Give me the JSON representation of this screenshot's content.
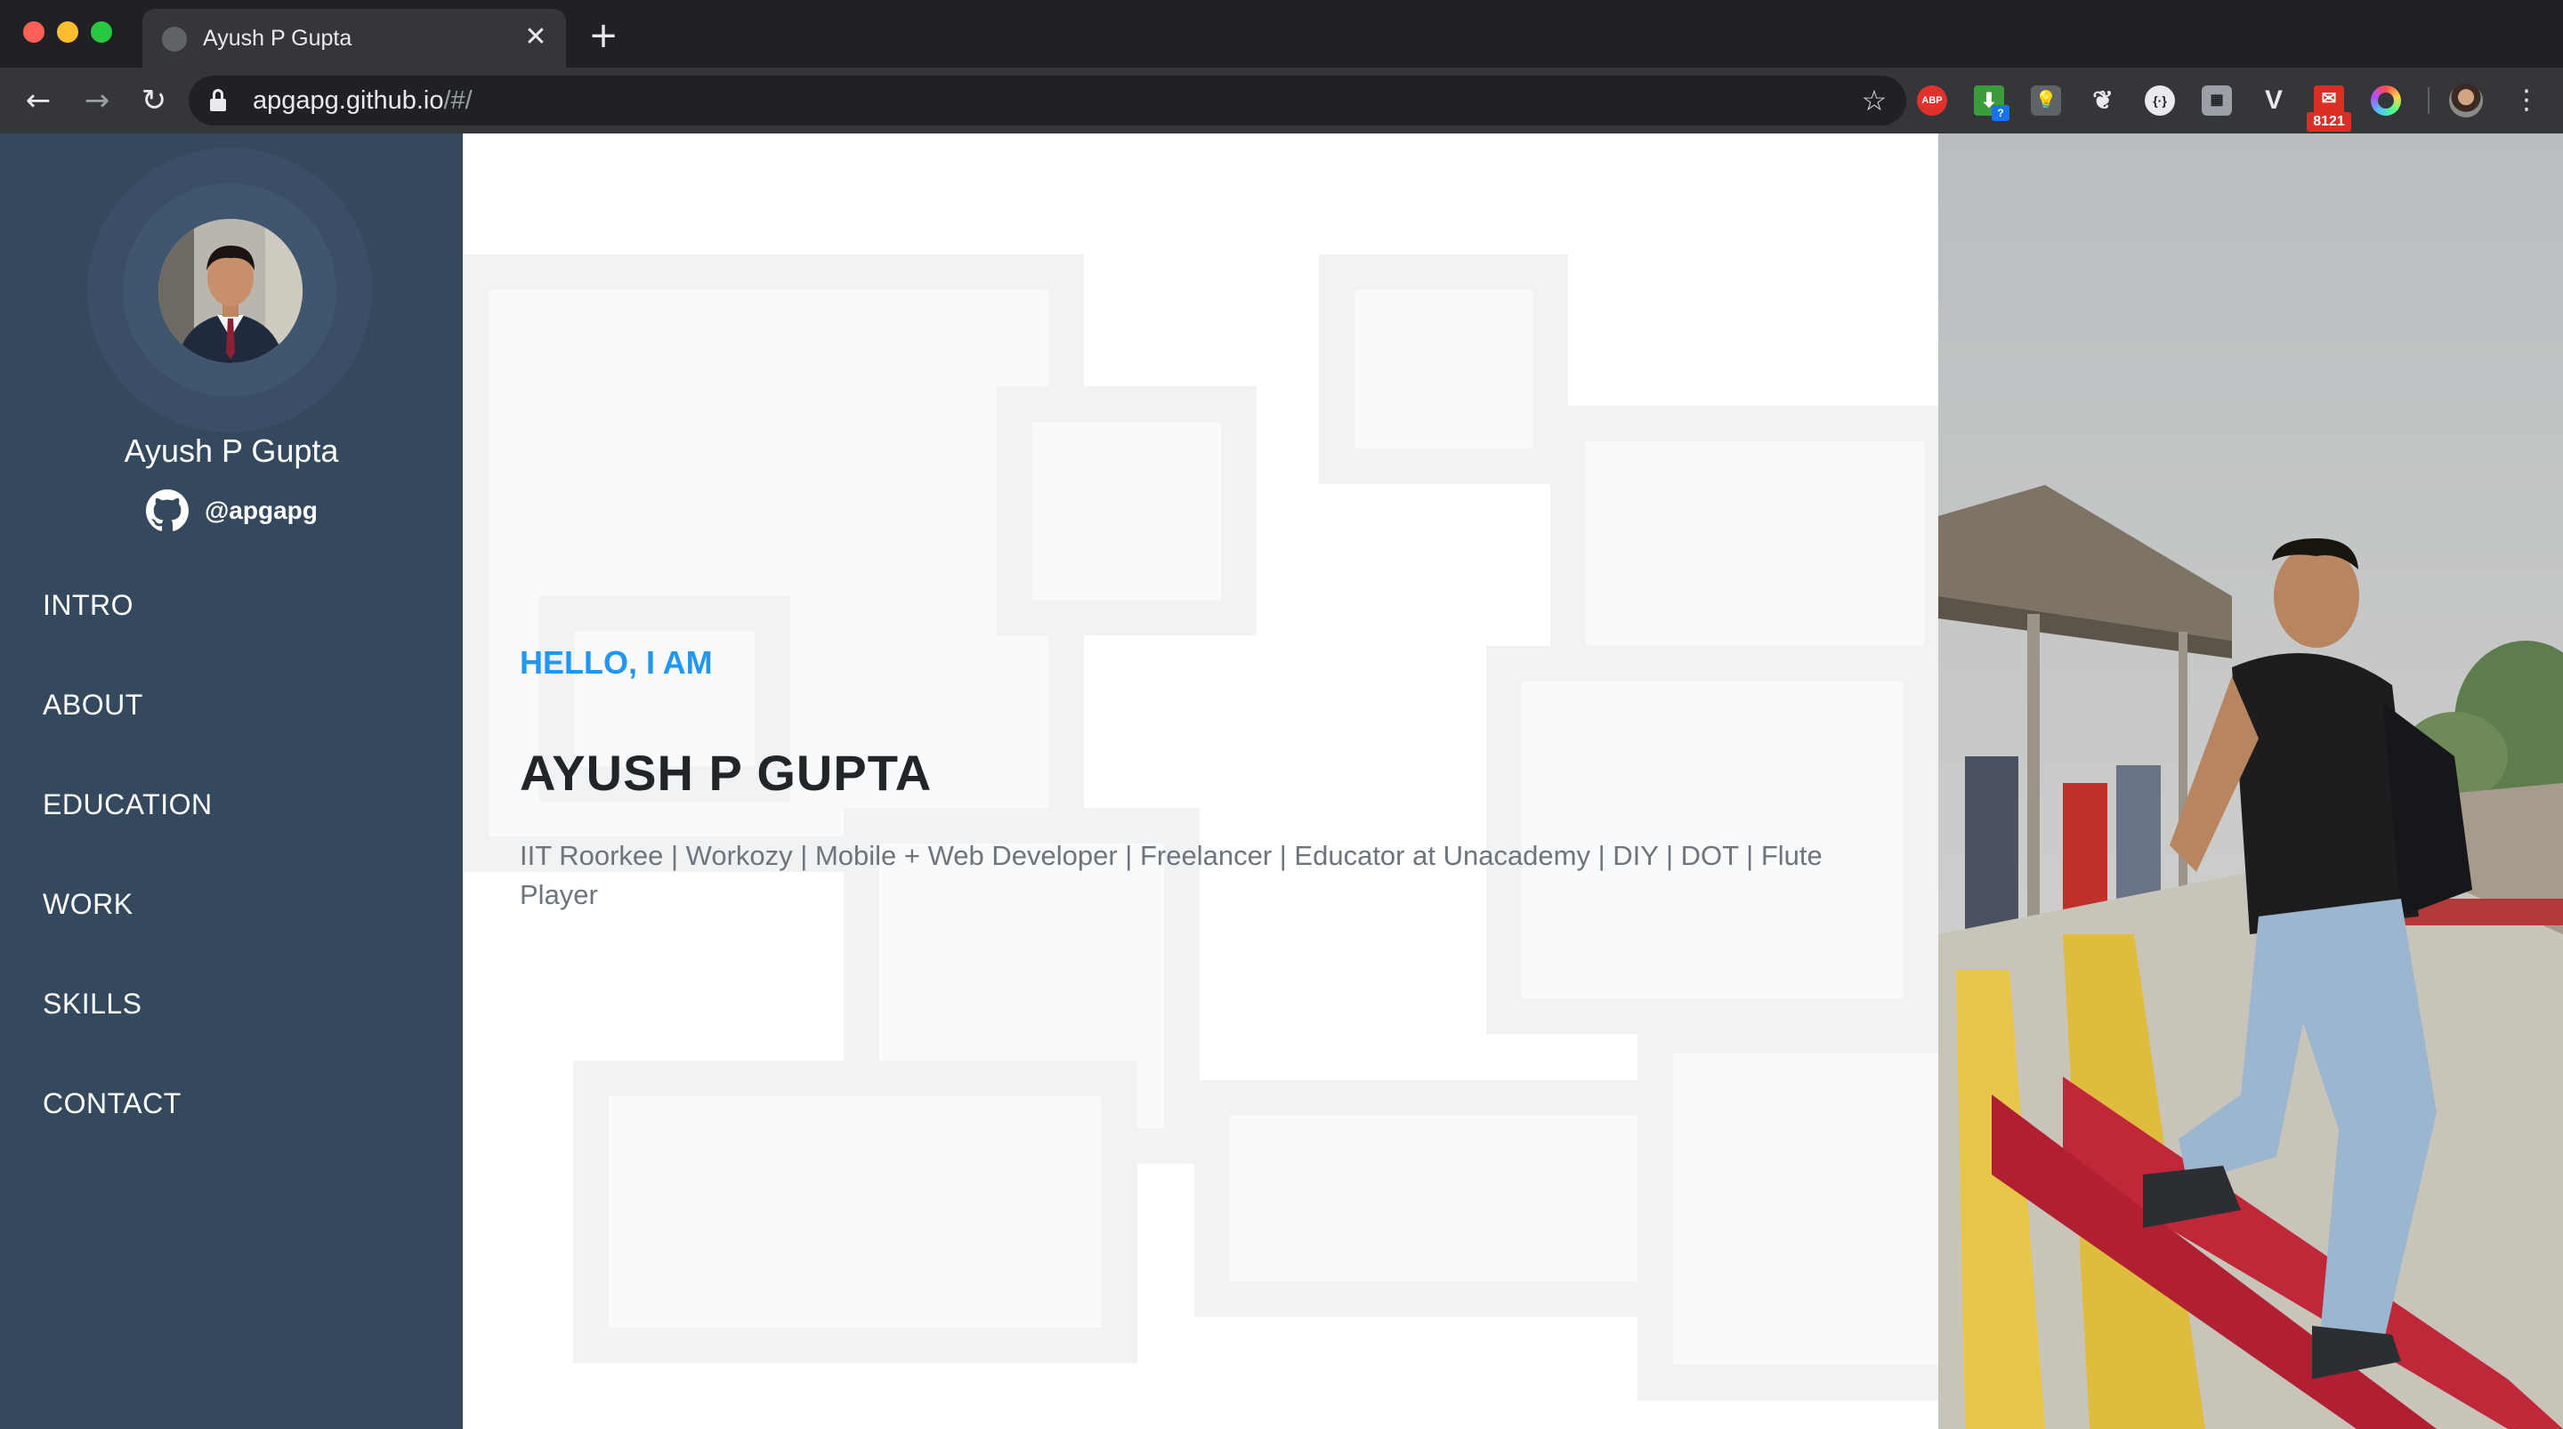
{
  "browser": {
    "tab_title": "Ayush P Gupta",
    "tab_close_glyph": "✕",
    "new_tab_glyph": "+",
    "url_host": "apgapg.github.io",
    "url_path": "/#/",
    "extensions": {
      "abp_label": "ABP",
      "download_badge": "?",
      "gmail_count": "8121"
    }
  },
  "sidebar": {
    "name": "Ayush P Gupta",
    "github_handle": "@apgapg",
    "menu": [
      {
        "label": "INTRO"
      },
      {
        "label": "ABOUT"
      },
      {
        "label": "EDUCATION"
      },
      {
        "label": "WORK"
      },
      {
        "label": "SKILLS"
      },
      {
        "label": "CONTACT"
      }
    ]
  },
  "intro": {
    "greeting": "HELLO, I AM",
    "name": "AYUSH P GUPTA",
    "tagline": "IIT Roorkee | Workozy | Mobile + Web Developer | Freelancer | Educator at Unacademy | DIY | DOT | Flute Player"
  },
  "colors": {
    "sidebar_bg": "#34495e",
    "accent": "#2196f3",
    "heading": "#212529",
    "muted": "#6c757d"
  }
}
